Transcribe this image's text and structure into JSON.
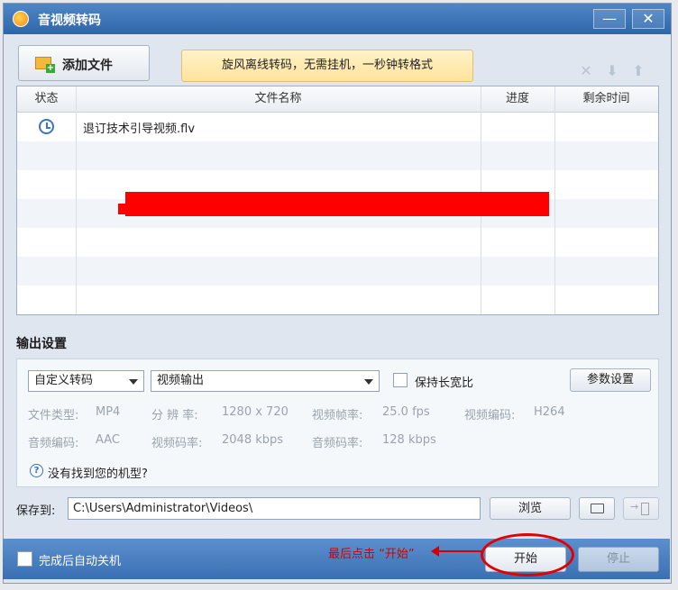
{
  "window": {
    "title": "音视频转码",
    "minimize": "—",
    "close": "✕"
  },
  "toolbar": {
    "add_file": "添加文件",
    "promo": "旋风离线转码，无需挂机，一秒钟转格式",
    "icons": [
      "delete-icon",
      "move-down-icon",
      "move-up-icon"
    ]
  },
  "table": {
    "columns": [
      "状态",
      "文件名称",
      "进度",
      "剩余时间"
    ],
    "rows": [
      {
        "status_icon": "clock-icon",
        "name": "退订技术引导视频.flv",
        "progress": "",
        "remaining": ""
      }
    ]
  },
  "output": {
    "section_title": "输出设置",
    "preset": "自定义转码",
    "format": "视频输出",
    "keep_ratio": "保持长宽比",
    "params_button": "参数设置",
    "specs": {
      "file_type_label": "文件类型:",
      "file_type": "MP4",
      "resolution_label": "分 辨 率:",
      "resolution": "1280 x 720",
      "framerate_label": "视频帧率:",
      "framerate": "25.0 fps",
      "vcodec_label": "视频编码:",
      "vcodec": "H264",
      "acodec_label": "音频编码:",
      "acodec": "AAC",
      "vbitrate_label": "视频码率:",
      "vbitrate": "2048 kbps",
      "abitrate_label": "音频码率:",
      "abitrate": "128 kbps"
    },
    "help_text": "没有找到您的机型?"
  },
  "save": {
    "label": "保存到:",
    "path": "C:\\Users\\Administrator\\Videos\\",
    "browse": "浏览"
  },
  "bottom": {
    "auto_shutdown": "完成后自动关机",
    "annotation": "最后点击 “开始”",
    "start": "开始",
    "stop": "停止"
  },
  "colors": {
    "title_bar": "#2f66aa",
    "annotation_red": "#d40000",
    "promo_bg": "#ffe39b"
  }
}
